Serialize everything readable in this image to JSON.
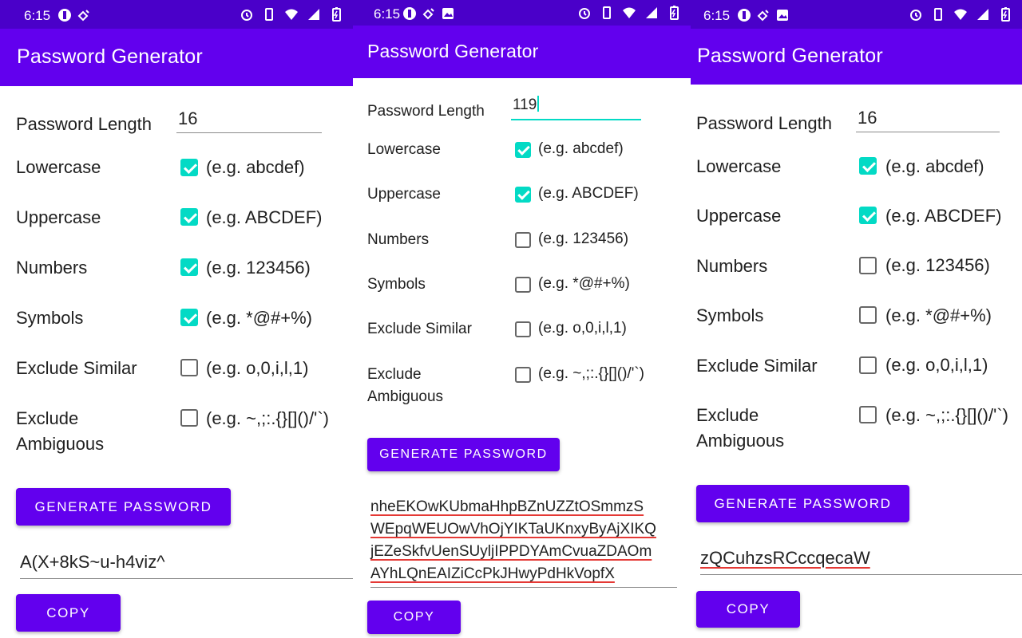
{
  "app_title": "Password Generator",
  "colors": {
    "status_bar": "#4a00c9",
    "app_bar": "#6200ee",
    "accent": "#03dac5",
    "spell_underline": "#e53935"
  },
  "options": {
    "lowercase": {
      "label": "Lowercase",
      "hint": "(e.g. abcdef)"
    },
    "uppercase": {
      "label": "Uppercase",
      "hint": "(e.g. ABCDEF)"
    },
    "numbers": {
      "label": "Numbers",
      "hint": "(e.g. 123456)"
    },
    "symbols": {
      "label": "Symbols",
      "hint": "(e.g. *@#+%)"
    },
    "exclude_similar": {
      "label": "Exclude Similar",
      "hint": "(e.g. o,0,i,l,1)"
    },
    "exclude_ambiguous": {
      "label_line1": "Exclude",
      "label_line2": "Ambiguous",
      "hint": "(e.g. ~,;:.{}[]()/'`)"
    }
  },
  "length_label": "Password Length",
  "generate_label": "GENERATE PASSWORD",
  "copy_label": "COPY",
  "screens": [
    {
      "time": "6:15",
      "length_value": "16",
      "checked": {
        "lowercase": true,
        "uppercase": true,
        "numbers": true,
        "symbols": true,
        "exclude_similar": false,
        "exclude_ambiguous": false
      },
      "password_lines": [
        "A(X+8kS~u-h4viz^"
      ]
    },
    {
      "time": "6:15",
      "length_value": "119",
      "checked": {
        "lowercase": true,
        "uppercase": true,
        "numbers": false,
        "symbols": false,
        "exclude_similar": false,
        "exclude_ambiguous": false
      },
      "password_lines": [
        "nheEKOwKUbmaHhpBZnUZZtOSmmzS",
        "WEpqWEUOwVhOjYIKTaUKnxyByAjXIKQ",
        "jEZeSkfvUenSUyljIPPDYAmCvuaZDAOm",
        "AYhLQnEAIZiCcPkJHwyPdHkVopfX"
      ]
    },
    {
      "time": "6:15",
      "length_value": "16",
      "checked": {
        "lowercase": true,
        "uppercase": true,
        "numbers": false,
        "symbols": false,
        "exclude_similar": false,
        "exclude_ambiguous": false
      },
      "password_lines": [
        "zQCuhzsRCccqecaW"
      ]
    }
  ]
}
